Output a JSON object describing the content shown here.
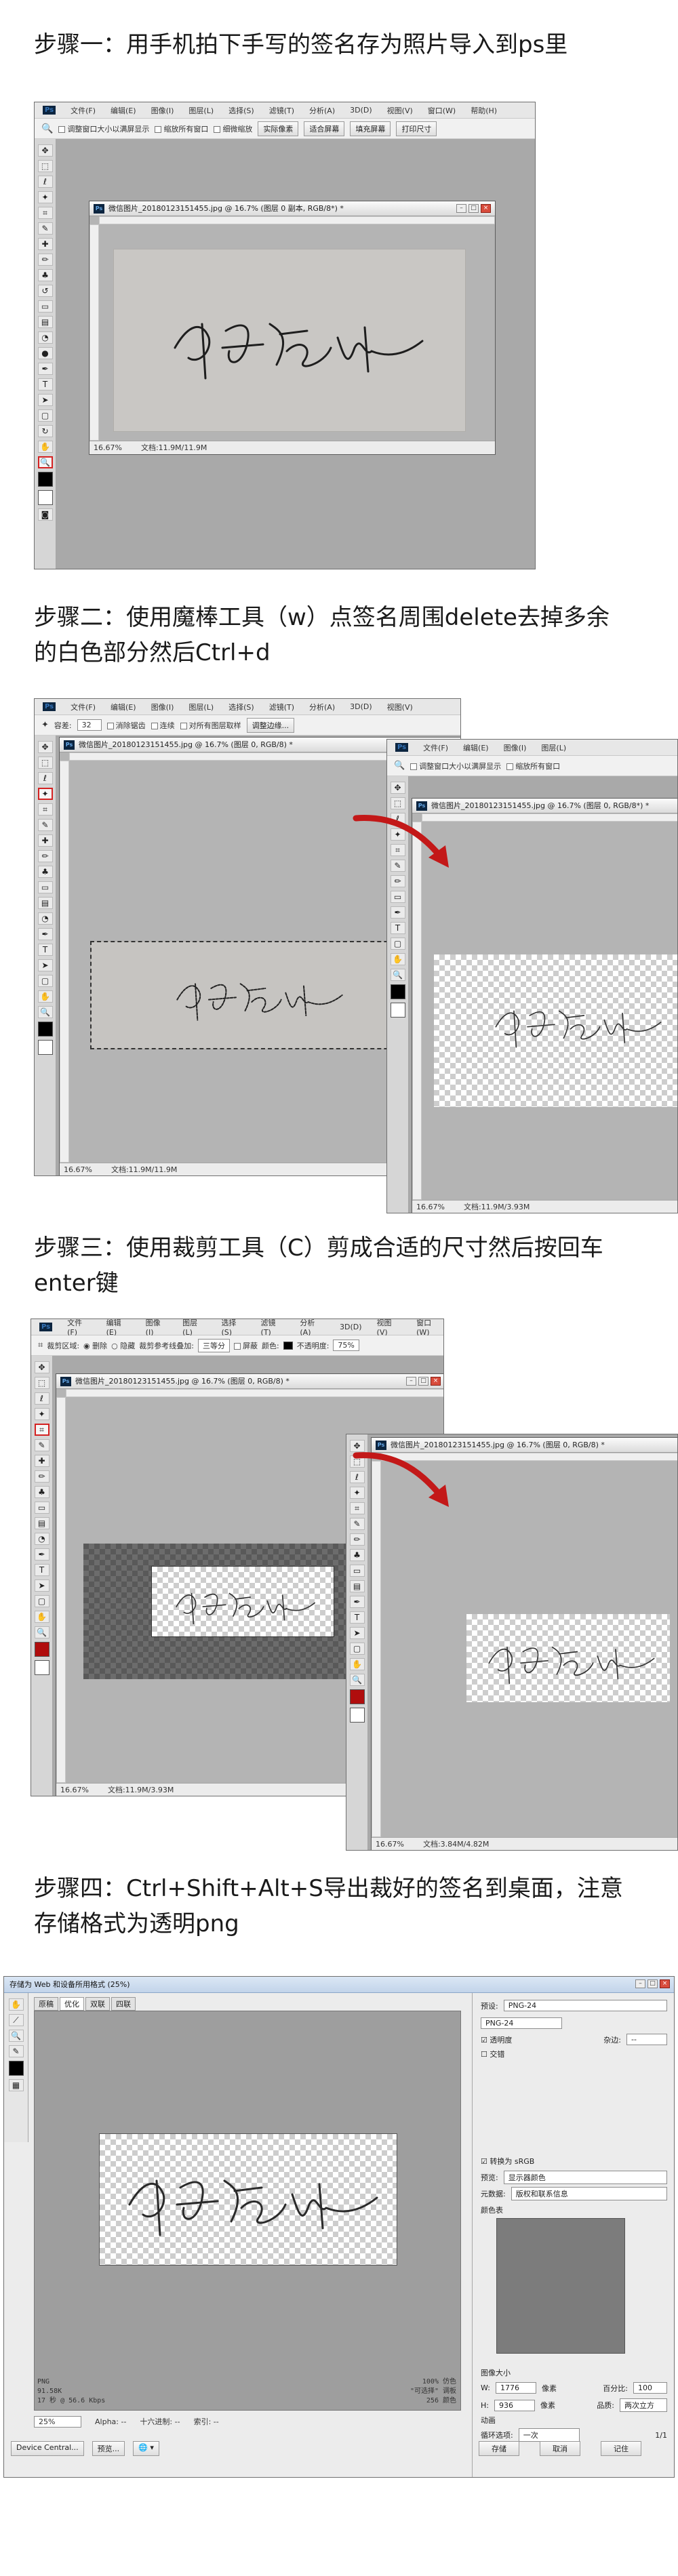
{
  "steps": [
    {
      "heading": "步骤一：用手机拍下手写的签名存为照片导入到ps里"
    },
    {
      "heading": "步骤二：使用魔棒工具（w）点签名周围delete去掉多余\n的白色部分然后Ctrl+d"
    },
    {
      "heading": "步骤三：使用裁剪工具（C）剪成合适的尺寸然后按回车\nenter键"
    },
    {
      "heading": "步骤四：Ctrl+Shift+Alt+S导出裁好的签名到桌面，注意\n存储格式为透明png"
    }
  ],
  "menu_items": [
    "文件(F)",
    "编辑(E)",
    "图像(I)",
    "图层(L)",
    "选择(S)",
    "滤镜(T)",
    "分析(A)",
    "3D(D)",
    "视图(V)",
    "窗口(W)",
    "帮助(H)"
  ],
  "ps_logo": "Ps",
  "shot1": {
    "options": [
      "调整窗口大小以满屏显示",
      "缩放所有窗口",
      "细微缩放"
    ],
    "buttons": [
      "实际像素",
      "适合屏幕",
      "填充屏幕",
      "打印尺寸"
    ],
    "doc_title": "微信图片_20180123151455.jpg @ 16.7% (图层 0 副本, RGB/8*) *",
    "zoom": "16.67%",
    "doc_info": "文档:11.9M/11.9M"
  },
  "shot2": {
    "tolerance_label": "容差:",
    "tolerance_value": "32",
    "options": [
      "消除锯齿",
      "连续",
      "对所有图层取样"
    ],
    "refine_button": "调整边缘...",
    "doc_title": "微信图片_20180123151455.jpg @ 16.7% (图层 0, RGB/8) *",
    "zoom": "16.67%",
    "doc_info": "文档:11.9M/11.9M",
    "after_doc_title": "微信图片_20180123151455.jpg @ 16.7% (图层 0, RGB/8*) *",
    "after_zoom": "16.67%",
    "after_doc_info": "文档:11.9M/3.93M",
    "after_options": [
      "调整窗口大小以满屏显示",
      "缩放所有窗口"
    ]
  },
  "shot3": {
    "crop_area_label": "裁剪区域:",
    "delete_label": "删除",
    "hide_label": "隐藏",
    "shield_label": "裁剪参考线叠加:",
    "thirds": "三等分",
    "shield_check": "屏蔽",
    "color_label": "颜色:",
    "opacity_label": "不透明度:",
    "opacity_value": "75%",
    "doc_title": "微信图片_20180123151455.jpg @ 16.7% (图层 0, RGB/8) *",
    "zoom": "16.67%",
    "doc_info": "文档:11.9M/3.93M",
    "after_doc_title": "微信图片_20180123151455.jpg @ 16.7% (图层 0, RGB/8) *",
    "after_zoom": "16.67%",
    "after_doc_info": "文档:3.84M/4.82M"
  },
  "shot4": {
    "window_title": "存储为 Web 和设备所用格式 (25%)",
    "tabs": [
      "原稿",
      "优化",
      "双联",
      "四联"
    ],
    "preset_label": "预设:",
    "preset_value": "PNG-24",
    "format_value": "PNG-24",
    "transparency": "透明度",
    "interlaced": "交错",
    "matte_label": "杂边:",
    "matte_value": "--",
    "convert_srgb": "转换为 sRGB",
    "preview_label": "预览:",
    "preview_value": "显示器颜色",
    "metadata_label": "元数据:",
    "metadata_value": "版权和联系信息",
    "color_table": "颜色表",
    "image_size": "图像大小",
    "w_label": "W:",
    "w_value": "1776",
    "h_label": "H:",
    "h_value": "936",
    "px_label": "像素",
    "percent_label": "百分比:",
    "percent_value": "100",
    "quality_label": "品质:",
    "quality_value": "两次立方",
    "anim_label": "动画",
    "loop_label": "循环选项:",
    "loop_value": "一次",
    "frame_counter": "1/1",
    "info_left": "PNG\n91.58K\n17 秒 @ 56.6 Kbps",
    "info_right": "100% 仿色\n\"可选择\" 调板\n256 颜色",
    "zoom_value": "25%",
    "alpha_label": "Alpha: --",
    "hex_label": "十六进制: --",
    "index_label": "索引: --",
    "device_button": "Device Central...",
    "preview_button": "预览...",
    "save_button": "存储",
    "cancel_button": "取消",
    "done_button": "记住"
  }
}
